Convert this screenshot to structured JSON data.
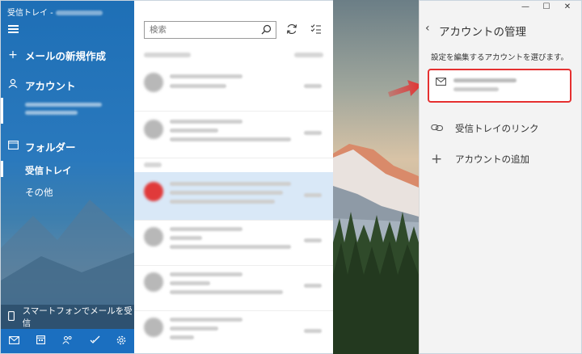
{
  "nav": {
    "title": "受信トレイ -",
    "new_mail": "メールの新規作成",
    "accounts": "アカウント",
    "folders": "フォルダー",
    "inbox": "受信トレイ",
    "other": "その他",
    "phone": "スマートフォンでメールを受信",
    "icons": [
      "mail-icon",
      "calendar-icon",
      "people-icon",
      "todo-icon",
      "settings-icon"
    ],
    "accent": "#1e6fb6"
  },
  "list": {
    "search_placeholder": "検索"
  },
  "panel": {
    "title": "アカウントの管理",
    "description": "設定を編集するアカウントを選びます。",
    "link_inboxes": "受信トレイのリンク",
    "add_account": "アカウントの追加",
    "highlight_color": "#e53030"
  }
}
